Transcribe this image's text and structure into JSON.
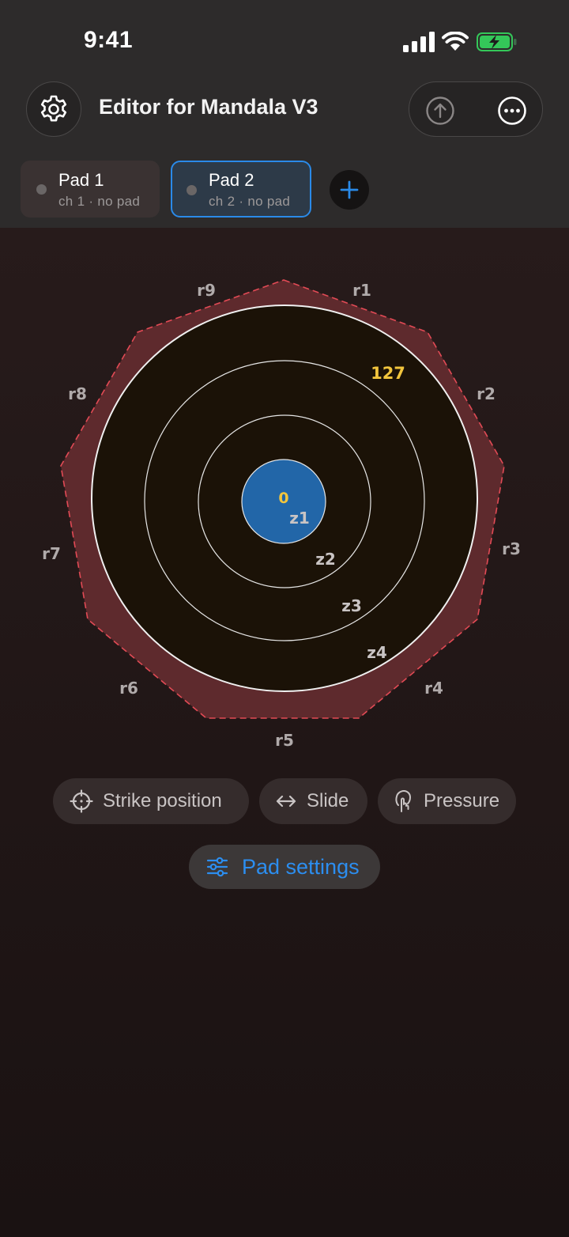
{
  "status_bar": {
    "time": "9:41"
  },
  "header": {
    "title": "Editor for Mandala V3"
  },
  "pads": [
    {
      "name": "Pad 1",
      "subtitle": "ch 1 · no pad",
      "selected": false
    },
    {
      "name": "Pad 2",
      "subtitle": "ch 2 · no pad",
      "selected": true
    }
  ],
  "pad_diagram": {
    "rim_labels": [
      "r1",
      "r2",
      "r3",
      "r4",
      "r5",
      "r6",
      "r7",
      "r8",
      "r9"
    ],
    "zone_labels": [
      "z1",
      "z2",
      "z3",
      "z4"
    ],
    "center_value": "0",
    "max_value": "127"
  },
  "modes": {
    "strike_position": "Strike position",
    "slide": "Slide",
    "pressure": "Pressure"
  },
  "pad_settings": {
    "label": "Pad settings"
  },
  "colors": {
    "accent": "#2a8ae8",
    "rim_fill": "#5e2a2d",
    "rim_stroke": "#e24a55",
    "pad_surface": "#1b1207",
    "center_zone": "#2266a8",
    "value_highlight": "#f2c53d",
    "battery": "#34c759"
  },
  "icons": {
    "settings": "gear-icon",
    "upload": "upload-icon",
    "more": "more-icon",
    "add": "plus-icon",
    "strike": "crosshair-icon",
    "slide": "arrow-left-right-icon",
    "pressure": "finger-press-icon",
    "pad_settings": "sliders-icon"
  }
}
